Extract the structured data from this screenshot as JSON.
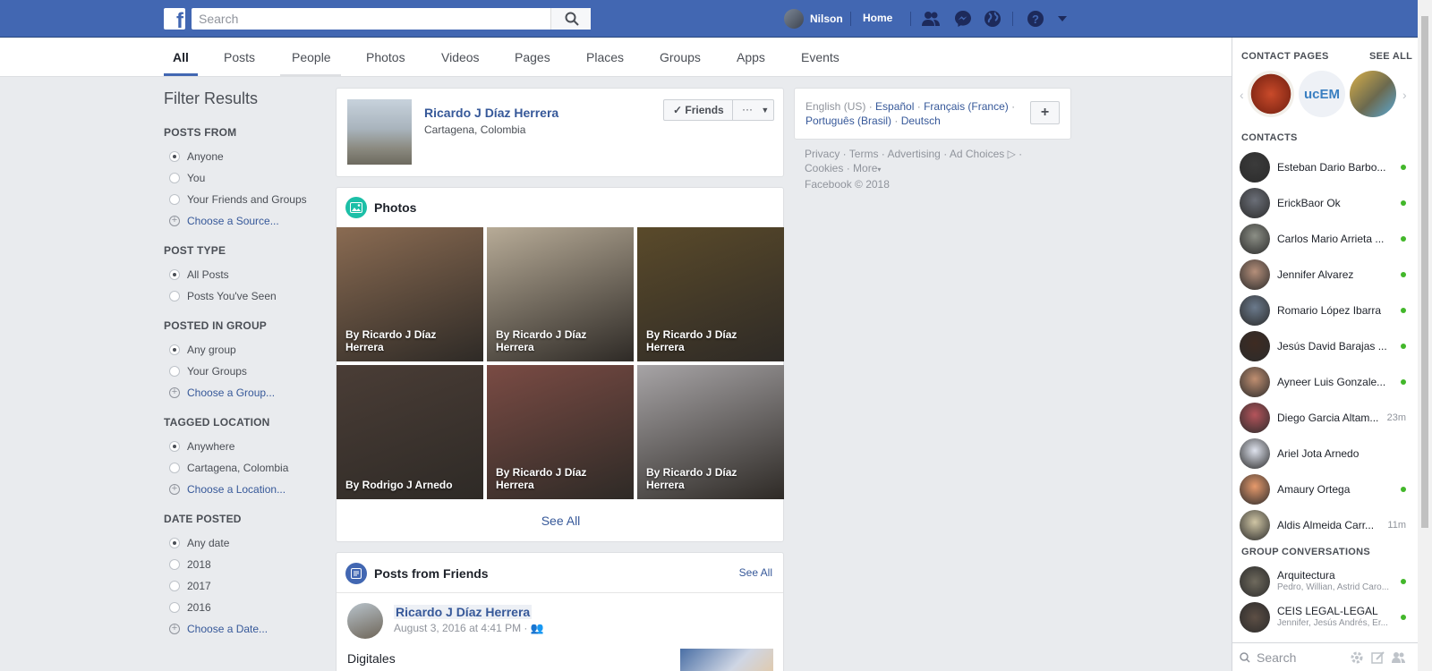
{
  "topbar": {
    "search_placeholder": "Search",
    "user_name": "Nilson",
    "home_label": "Home"
  },
  "tabs": [
    "All",
    "Posts",
    "People",
    "Photos",
    "Videos",
    "Pages",
    "Places",
    "Groups",
    "Apps",
    "Events"
  ],
  "filters": {
    "title": "Filter Results",
    "groups": [
      {
        "title": "POSTS FROM",
        "options": [
          {
            "label": "Anyone",
            "type": "radio",
            "selected": true
          },
          {
            "label": "You",
            "type": "radio"
          },
          {
            "label": "Your Friends and Groups",
            "type": "radio"
          },
          {
            "label": "Choose a Source...",
            "type": "link"
          }
        ]
      },
      {
        "title": "POST TYPE",
        "options": [
          {
            "label": "All Posts",
            "type": "radio",
            "selected": true
          },
          {
            "label": "Posts You've Seen",
            "type": "radio"
          }
        ]
      },
      {
        "title": "POSTED IN GROUP",
        "options": [
          {
            "label": "Any group",
            "type": "radio",
            "selected": true
          },
          {
            "label": "Your Groups",
            "type": "radio"
          },
          {
            "label": "Choose a Group...",
            "type": "link"
          }
        ]
      },
      {
        "title": "TAGGED LOCATION",
        "options": [
          {
            "label": "Anywhere",
            "type": "radio",
            "selected": true
          },
          {
            "label": "Cartagena, Colombia",
            "type": "radio"
          },
          {
            "label": "Choose a Location...",
            "type": "link"
          }
        ]
      },
      {
        "title": "DATE POSTED",
        "options": [
          {
            "label": "Any date",
            "type": "radio",
            "selected": true
          },
          {
            "label": "2018",
            "type": "radio"
          },
          {
            "label": "2017",
            "type": "radio"
          },
          {
            "label": "2016",
            "type": "radio"
          },
          {
            "label": "Choose a Date...",
            "type": "link"
          }
        ]
      }
    ]
  },
  "person": {
    "name": "Ricardo J Díaz Herrera",
    "location": "Cartagena, Colombia",
    "friends_label": "Friends",
    "more_label": "···"
  },
  "photos": {
    "title": "Photos",
    "see_all": "See All",
    "items": [
      {
        "caption": "By Ricardo J Díaz Herrera",
        "color": "#8a6b52"
      },
      {
        "caption": "By Ricardo J Díaz Herrera",
        "color": "#b7ab97"
      },
      {
        "caption": "By Ricardo J Díaz Herrera",
        "color": "#5a4a2a"
      },
      {
        "caption": "By Rodrigo J Arnedo",
        "color": "#4a3d36"
      },
      {
        "caption": "By Ricardo J Díaz Herrera",
        "color": "#7a4b44"
      },
      {
        "caption": "By Ricardo J Díaz Herrera",
        "color": "#a7a4a6"
      }
    ]
  },
  "posts_from_friends": {
    "title": "Posts from Friends",
    "see_all": "See All",
    "author": "Ricardo J Díaz Herrera",
    "date": "August 3, 2016 at 4:41 PM ·",
    "text": "Digitales"
  },
  "languages": {
    "current": "English (US)",
    "links": [
      "Español",
      "Français (France)",
      "Português (Brasil)",
      "Deutsch"
    ],
    "plus": "+"
  },
  "footer": {
    "links": [
      "Privacy",
      "Terms",
      "Advertising",
      "Ad Choices",
      "Cookies",
      "More"
    ],
    "copyright": "Facebook © 2018"
  },
  "chat": {
    "contact_pages_title": "CONTACT PAGES",
    "see_all": "SEE ALL",
    "contacts_title": "CONTACTS",
    "contacts": [
      {
        "name": "Esteban Dario Barbo...",
        "status": "online",
        "color": "#3b3b3b"
      },
      {
        "name": "ErickBaor Ok",
        "status": "online",
        "color": "#6b6f78"
      },
      {
        "name": "Carlos Mario Arrieta ...",
        "status": "online",
        "color": "#8c8f86"
      },
      {
        "name": "Jennifer Alvarez",
        "status": "online",
        "color": "#b58f7a"
      },
      {
        "name": "Romario López Ibarra",
        "status": "online",
        "color": "#6b7a8c"
      },
      {
        "name": "Jesús David Barajas ...",
        "status": "online",
        "color": "#3e2b22"
      },
      {
        "name": "Ayneer Luis Gonzale...",
        "status": "online",
        "color": "#c08f71"
      },
      {
        "name": "Diego Garcia Altam...",
        "status": "23m",
        "color": "#b5545b"
      },
      {
        "name": "Ariel Jota Arnedo",
        "status": "",
        "color": "#dfe3ee"
      },
      {
        "name": "Amaury Ortega",
        "status": "online",
        "color": "#e79a6c"
      },
      {
        "name": "Aldis Almeida Carr...",
        "status": "11m",
        "color": "#cfc5a4"
      }
    ],
    "group_title": "GROUP CONVERSATIONS",
    "groups": [
      {
        "name": "Arquitectura",
        "members": "Pedro, Willian, Astrid Caro...",
        "color": "#6f6a5d"
      },
      {
        "name": "CEIS LEGAL-LEGAL",
        "members": "Jennifer, Jesús Andrés, Er...",
        "color": "#5d4f45"
      }
    ],
    "search_placeholder": "Search"
  }
}
